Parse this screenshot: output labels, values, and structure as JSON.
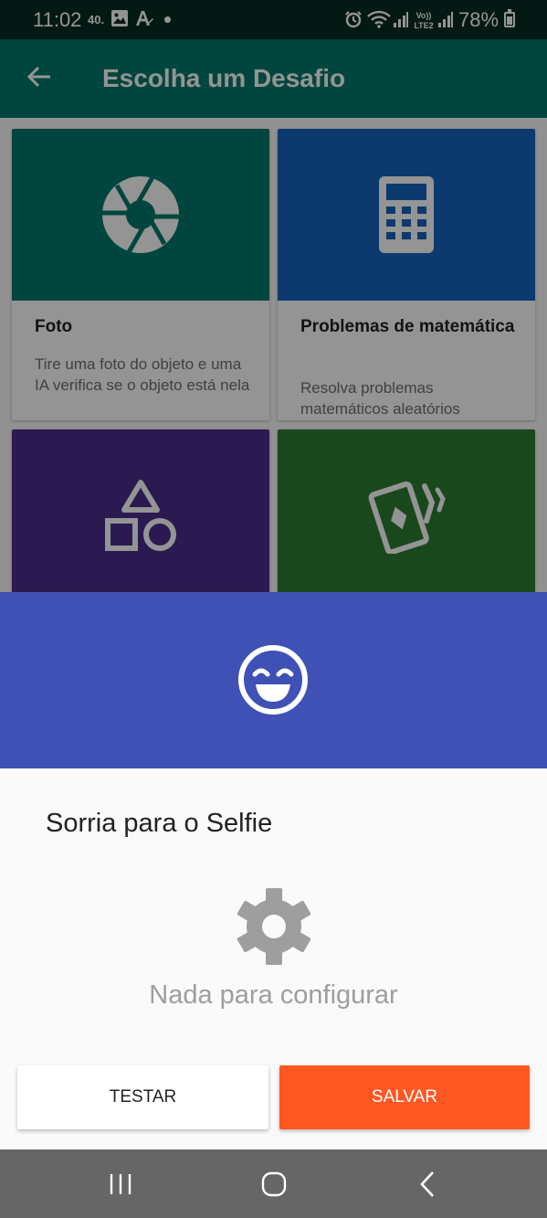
{
  "status_bar": {
    "time": "11:02",
    "network_label": "40.",
    "battery_percent": "78%",
    "left_icons": [
      "image-icon",
      "auto-text-icon",
      "notification-dot-icon"
    ],
    "right_icons": [
      "alarm-icon",
      "wifi-icon",
      "signal-icon",
      "volte-icon",
      "signal-icon",
      "battery-icon"
    ]
  },
  "app_bar": {
    "back_icon": "arrow-left-icon",
    "title": "Escolha um Desafio",
    "color": "#00796B"
  },
  "challenges": [
    {
      "title": "Foto",
      "description": "Tire uma foto do objeto e uma IA verifica se o objeto está nela",
      "icon": "camera-aperture-icon",
      "color": "#00796B"
    },
    {
      "title": "Problemas de matemática",
      "description": "Resolva problemas matemáticos aleatórios",
      "icon": "calculator-icon",
      "color": "#1565C0"
    },
    {
      "title": "",
      "description": "",
      "icon": "shapes-icon",
      "color": "#4A2B8C"
    },
    {
      "title": "",
      "description": "",
      "icon": "cards-icon",
      "color": "#2E7D32"
    }
  ],
  "dialog": {
    "header_icon": "smiling-face-icon",
    "header_color": "#3F51B5",
    "title": "Sorria para o Selfie",
    "settings_icon": "gear-icon",
    "empty_message": "Nada para configurar",
    "test_label": "TESTAR",
    "save_label": "SALVAR",
    "save_color": "#FF5722"
  },
  "nav_bar": {
    "buttons": [
      "recent-apps-icon",
      "home-icon",
      "back-icon"
    ]
  }
}
